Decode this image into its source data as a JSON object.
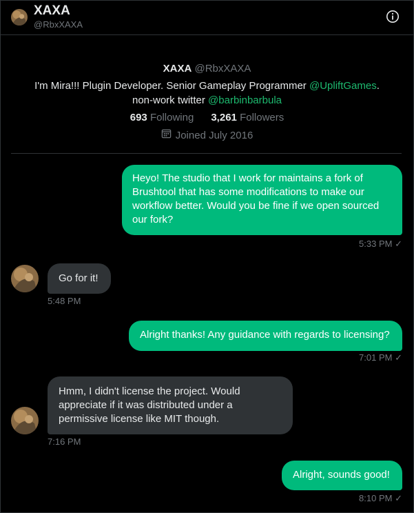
{
  "header": {
    "name": "XAXA",
    "handle": "@RbxXAXA",
    "info_icon": "info-icon"
  },
  "profile": {
    "name": "XAXA",
    "handle": "@RbxXAXA",
    "bio_part1": "I'm Mira!!! Plugin Developer. Senior Gameplay Programmer ",
    "bio_link1": "@UpliftGames",
    "bio_part2": ".",
    "bio_part3": "non-work twitter ",
    "bio_link2": "@barbinbarbula",
    "following_count": "693",
    "following_label": "Following",
    "followers_count": "3,261",
    "followers_label": "Followers",
    "joined": "Joined July 2016"
  },
  "messages": [
    {
      "direction": "sent",
      "text": "Heyo! The studio that I work for maintains a fork of Brushtool that has some modifications to make our workflow better. Would you be fine if we open sourced our fork?",
      "time": "5:33 PM",
      "check": "✓"
    },
    {
      "direction": "received",
      "text": "Go for it!",
      "time": "5:48 PM"
    },
    {
      "direction": "sent",
      "text": "Alright thanks! Any guidance with regards to licensing?",
      "time": "7:01 PM",
      "check": "✓"
    },
    {
      "direction": "received",
      "text": "Hmm, I didn't license the project. Would appreciate if it was distributed under a permissive license like MIT though.",
      "time": "7:16 PM"
    },
    {
      "direction": "sent",
      "text": "Alright, sounds good!",
      "time": "8:10 PM",
      "check": "✓"
    }
  ],
  "colors": {
    "background": "#000000",
    "sent_bubble": "#00ba7c",
    "received_bubble": "#2f3336",
    "link": "#1dba6f",
    "muted": "#71767b"
  }
}
